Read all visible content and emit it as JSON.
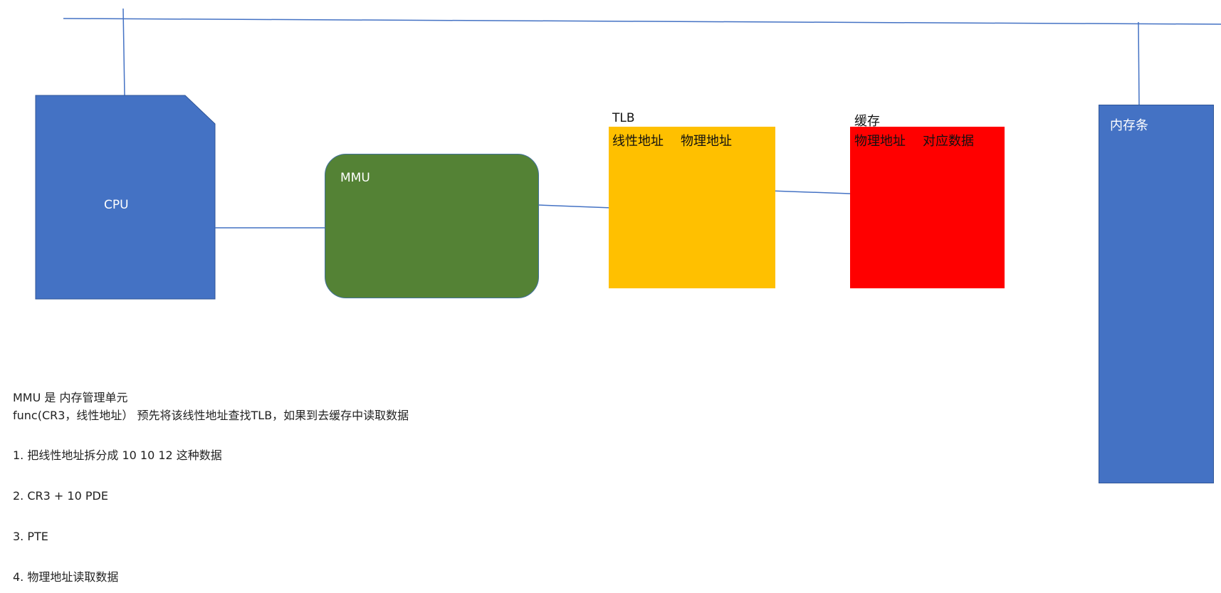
{
  "diagram": {
    "cpu": {
      "label": "CPU"
    },
    "mmu": {
      "label": "MMU"
    },
    "tlb": {
      "title": "TLB",
      "col1": "线性地址",
      "col2": "物理地址"
    },
    "cache": {
      "title": "缓存",
      "col1": "物理地址",
      "col2": "对应数据"
    },
    "ram": {
      "label": "内存条"
    }
  },
  "notes": {
    "line1": "MMU 是 内存管理单元",
    "line2": "func(CR3，线性地址）  预先将该线性地址查找TLB，如果到去缓存中读取数据",
    "step1": "1. 把线性地址拆分成 10 10 12 这种数据",
    "step2": "2. CR3 + 10 PDE",
    "step3": "3. PTE",
    "step4": "4. 物理地址读取数据"
  },
  "colors": {
    "cpu": "#4472c4",
    "mmu": "#548235",
    "tlb": "#ffc000",
    "cache": "#ff0000",
    "ram": "#4472c4",
    "connector": "#4472c4"
  }
}
